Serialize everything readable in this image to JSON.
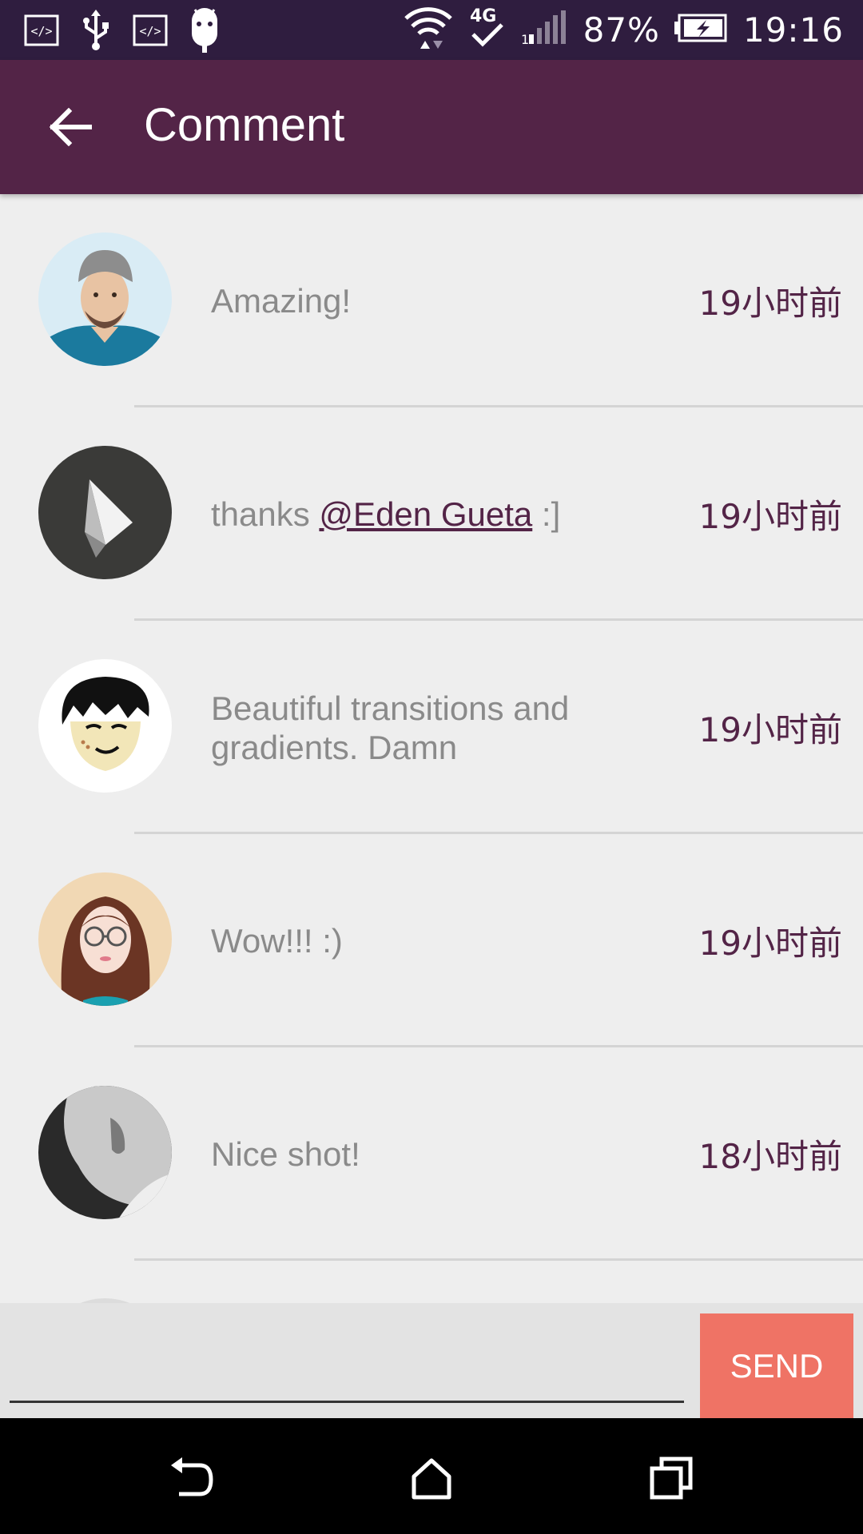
{
  "status_bar": {
    "battery": "87%",
    "time": "19:16",
    "network": "4G",
    "icons": [
      "code-icon",
      "usb-icon",
      "code-icon",
      "android-icon",
      "wifi-icon",
      "network-4g-icon",
      "signal-icon",
      "battery-charging-icon"
    ]
  },
  "app_bar": {
    "title": "Comment",
    "back_icon": "arrow-back-icon",
    "background": "#532447"
  },
  "comments": [
    {
      "avatar": "avatar-man-beanie",
      "text": "Amazing!",
      "mention": "",
      "after": "",
      "time": "19小时前"
    },
    {
      "avatar": "avatar-logo-dark",
      "text": "thanks ",
      "mention": "@Eden Gueta",
      "after": " :]",
      "time": "19小时前"
    },
    {
      "avatar": "avatar-cartoon-boy",
      "text": "Beautiful transitions and gradients. Damn",
      "mention": "",
      "after": "",
      "time": "19小时前"
    },
    {
      "avatar": "avatar-cartoon-girl",
      "text": "Wow!!! :)",
      "mention": "",
      "after": "",
      "time": "19小时前"
    },
    {
      "avatar": "avatar-bw-profile",
      "text": "Nice shot!",
      "mention": "",
      "after": "",
      "time": "18小时前"
    }
  ],
  "input": {
    "value": "",
    "placeholder": "",
    "send_label": "SEND",
    "send_color": "#ef7365"
  },
  "nav_bar": {
    "icons": [
      "back-nav-icon",
      "home-icon",
      "recents-icon"
    ]
  }
}
